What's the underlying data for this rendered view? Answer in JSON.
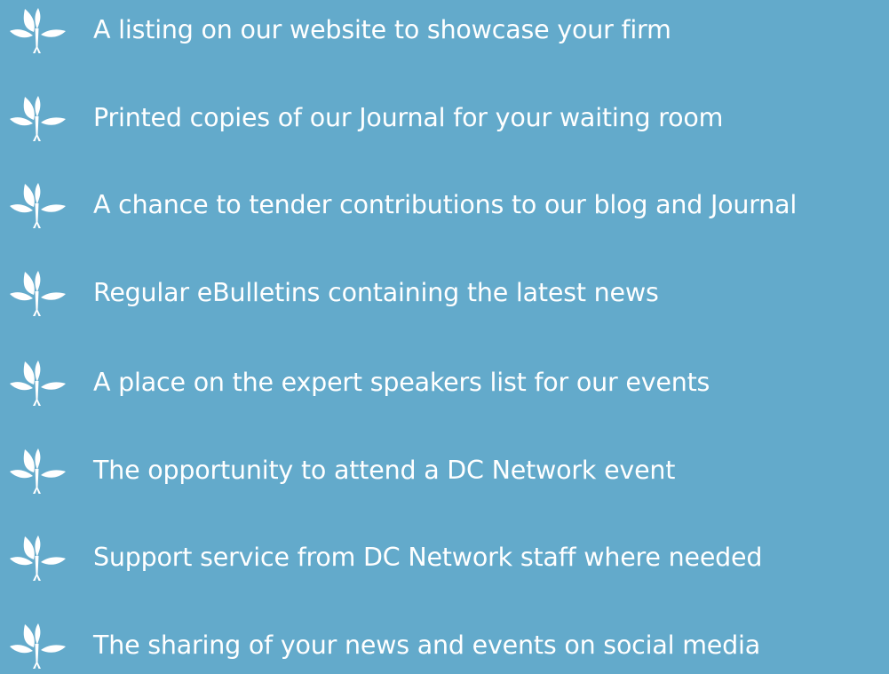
{
  "benefits": [
    {
      "label": "A listing on our website to showcase your firm",
      "icon": "leaf-sprig-icon"
    },
    {
      "label": "Printed copies of our Journal for your waiting room",
      "icon": "leaf-sprig-icon"
    },
    {
      "label": "A chance to tender contributions to our blog and Journal",
      "icon": "leaf-sprig-icon"
    },
    {
      "label": "Regular eBulletins containing the latest news",
      "icon": "leaf-sprig-icon"
    },
    {
      "label": "A place on the expert speakers list for our events",
      "icon": "leaf-sprig-icon"
    },
    {
      "label": "The opportunity to attend a DC Network event",
      "icon": "leaf-sprig-icon"
    },
    {
      "label": "Support service from DC Network staff where needed",
      "icon": "leaf-sprig-icon"
    },
    {
      "label": "The sharing of your news and events on social media",
      "icon": "leaf-sprig-icon"
    }
  ],
  "colors": {
    "background": "#63aacb",
    "text": "#ffffff",
    "icon": "#ffffff"
  }
}
